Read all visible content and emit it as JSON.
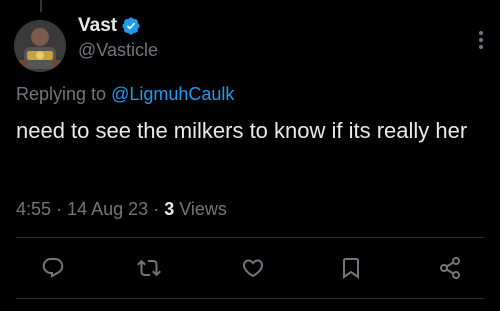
{
  "tweet": {
    "author": {
      "display_name": "Vast",
      "handle": "@Vasticle",
      "verified": true,
      "verified_color": "#1d9bf0"
    },
    "replying_to": {
      "prefix": "Replying to",
      "mention": "@LigmuhCaulk"
    },
    "text": "need to see the milkers to know if its really her",
    "time": "4:55",
    "separator_1": "·",
    "date": "14 Aug 23",
    "separator_2": "·",
    "views_count": "3",
    "views_label": "Views"
  },
  "actions": {
    "reply": "reply-icon",
    "retweet": "retweet-icon",
    "like": "heart-icon",
    "bookmark": "bookmark-icon",
    "share": "share-icon"
  },
  "colors": {
    "background": "#000000",
    "primary_text": "#e7e9ea",
    "secondary_text": "#71767b",
    "accent": "#1d9bf0",
    "divider": "#2f3336"
  }
}
